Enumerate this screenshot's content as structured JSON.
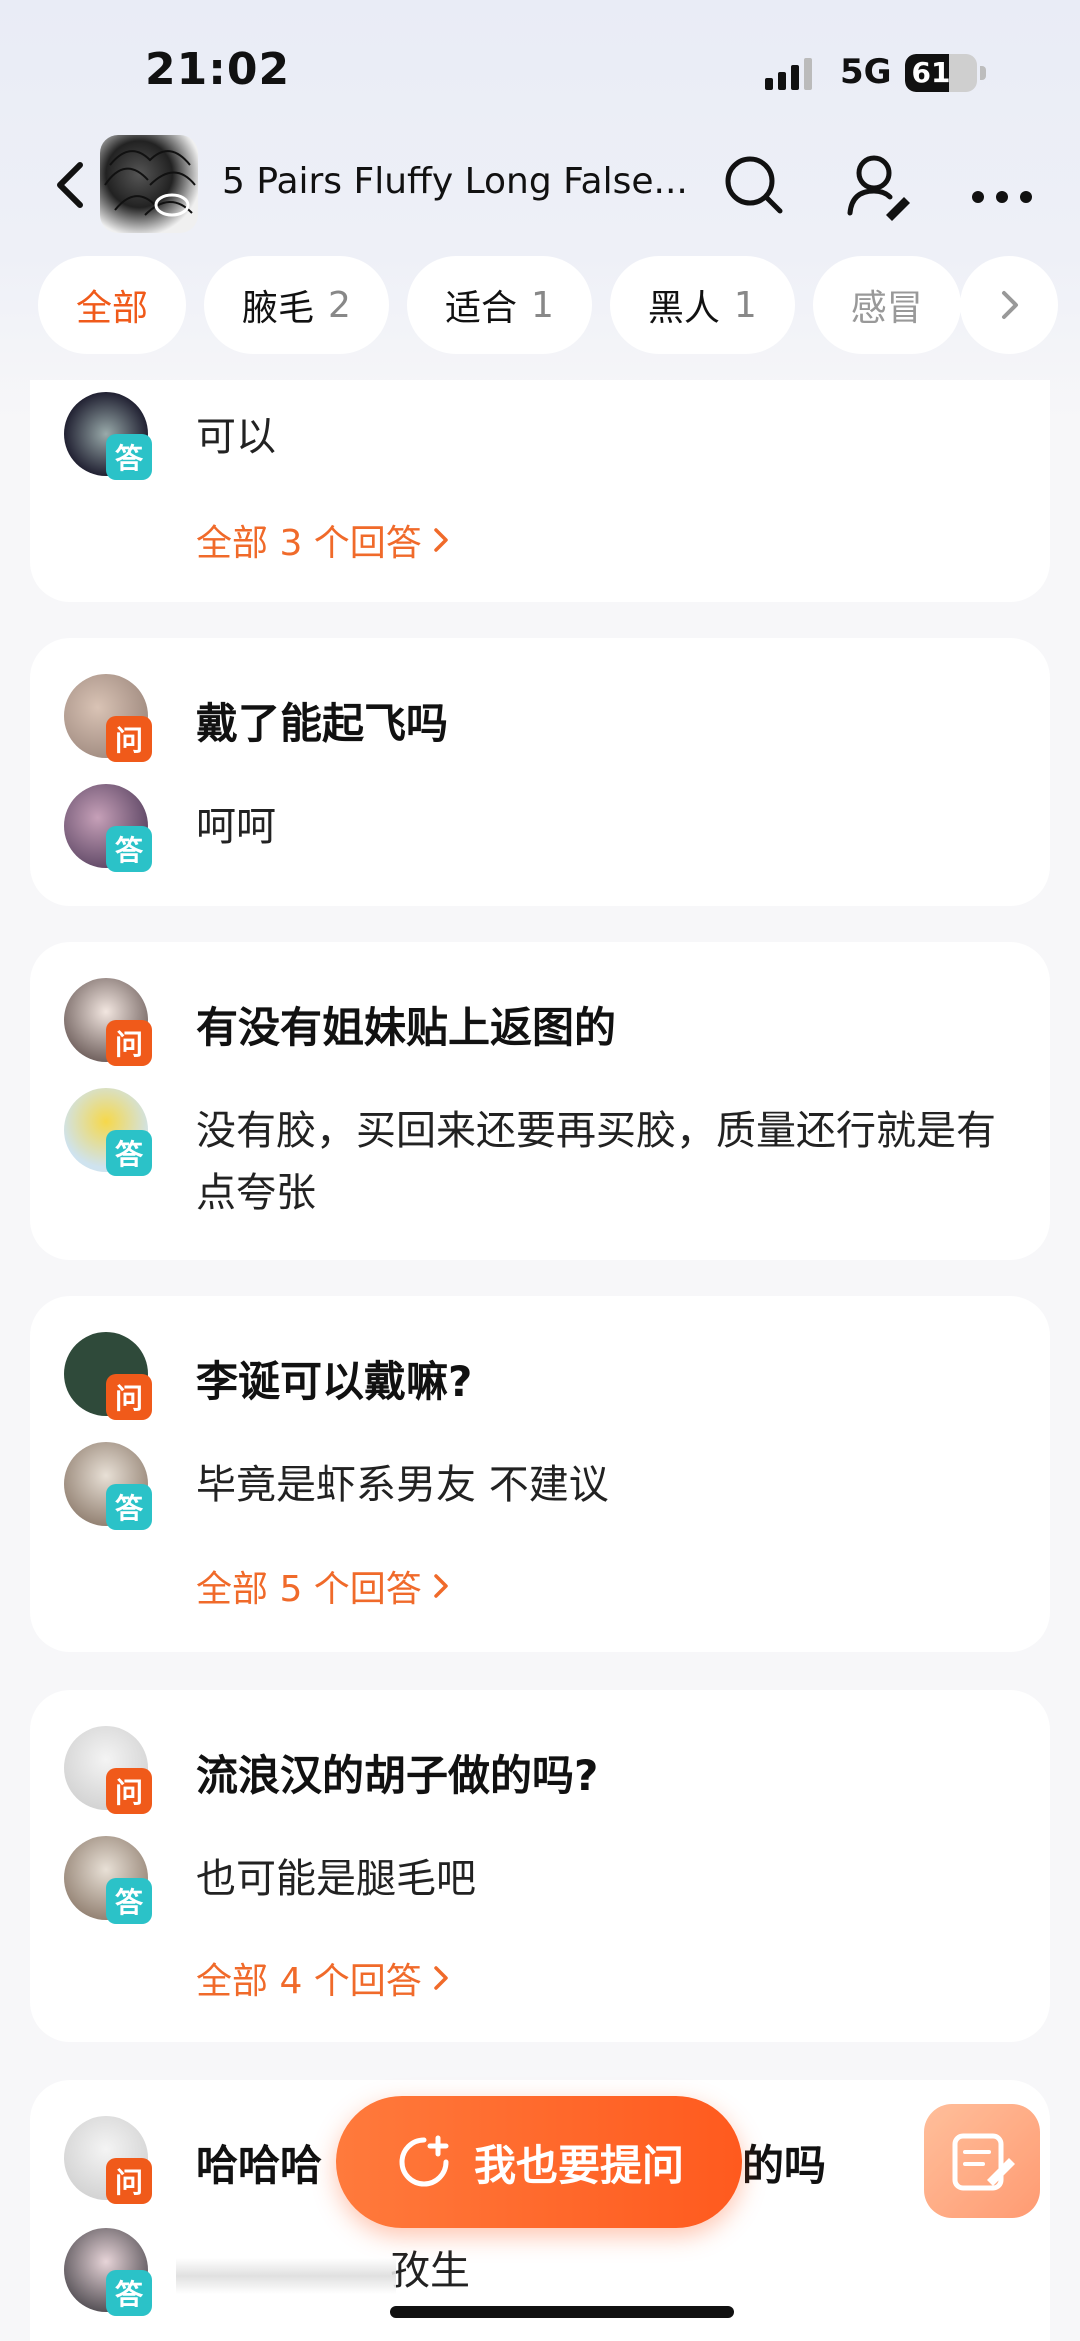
{
  "status": {
    "time": "21:02",
    "network": "5G",
    "battery": "61",
    "battery_level": 0.61
  },
  "nav": {
    "product_title": "5 Pairs Fluffy Long False...",
    "icons": [
      "back-icon",
      "search-icon",
      "user-follow-icon",
      "more-icon"
    ]
  },
  "chips": [
    {
      "label": "全部",
      "count": ""
    },
    {
      "label": "腋毛",
      "count": "2"
    },
    {
      "label": "适合",
      "count": "1"
    },
    {
      "label": "黑人",
      "count": "1"
    },
    {
      "label": "感冒",
      "count": ""
    }
  ],
  "badges": {
    "question": "问",
    "answer": "答"
  },
  "cards": [
    {
      "question": "",
      "answer": "可以",
      "more": "全部 3 个回答"
    },
    {
      "question": "戴了能起飞吗",
      "answer": "呵呵",
      "more": ""
    },
    {
      "question": "有没有姐妹贴上返图的",
      "answer": "没有胶，买回来还要再买胶，质量还行就是有点夸张",
      "more": ""
    },
    {
      "question": "李诞可以戴嘛?",
      "answer": "毕竟是虾系男友 不建议",
      "more": "全部 5 个回答"
    },
    {
      "question": "流浪汉的胡子做的吗?",
      "answer": "也可能是腿毛吧",
      "more": "全部 4 个回答"
    },
    {
      "question_left": "哈哈哈",
      "question_right": "的吗",
      "answer": "孜生"
    }
  ],
  "fab": {
    "label": "我也要提问"
  },
  "colors": {
    "accent": "#f05a1a",
    "answer_badge": "#2bc2c8",
    "link": "#f06a2a"
  }
}
